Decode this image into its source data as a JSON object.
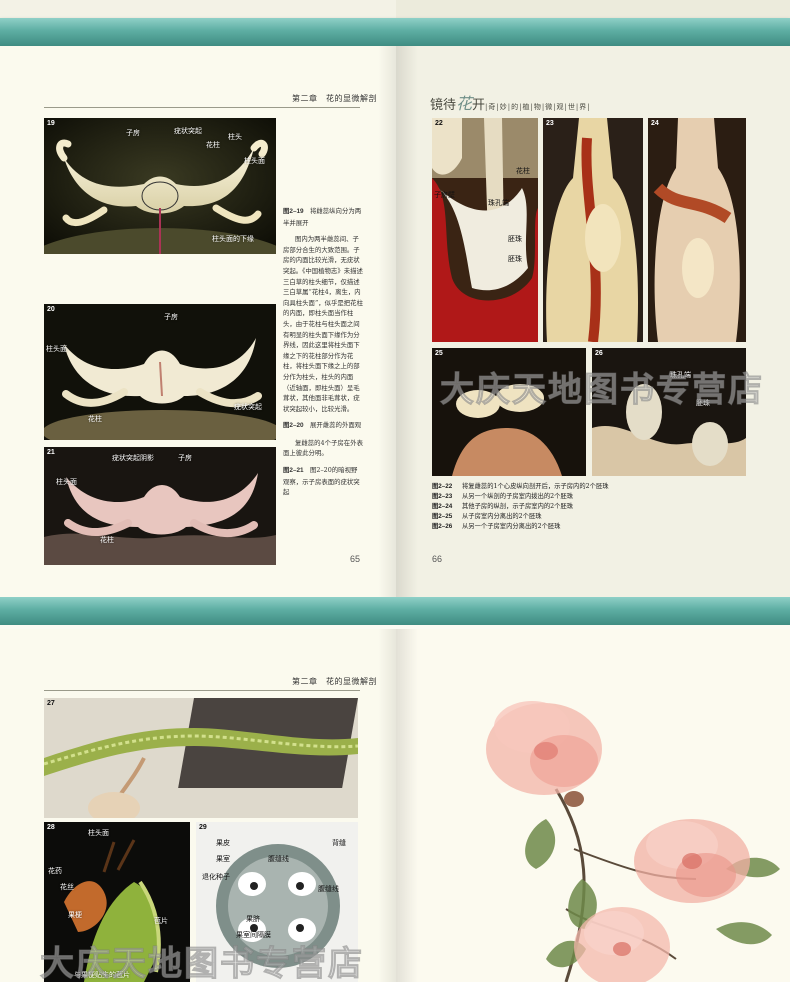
{
  "spread1": {
    "running_head_left": "第二章　花的显微解剖",
    "book_title_big": "镜待",
    "book_title_hua": "花",
    "book_title_kai": "开",
    "book_title_sub": "|奇|妙|的|植|物|微|观|世|界|",
    "folio_left": "65",
    "folio_right": "66",
    "figures_left": [
      {
        "num": "19",
        "labels": [
          "子房",
          "疣状突起",
          "花柱",
          "柱头",
          "柱头面",
          "柱头面的下缘"
        ]
      },
      {
        "num": "20",
        "labels": [
          "子房",
          "柱头面",
          "疣状突起",
          "花柱"
        ]
      },
      {
        "num": "21",
        "labels": [
          "疣状突起阴影",
          "子房",
          "柱头面",
          "花柱"
        ]
      }
    ],
    "caption_219_label": "图2–19",
    "caption_219_head": "将雌蕊纵向分为两半并展开",
    "caption_219_body": "图内为两半雌蕊间、子房部分合生的大致范围。子房的内面比较光滑，无疣状突起。《中国植物志》未描述三白草的柱头细节，仅描述三白草属“花柱4，离生，内向具柱头面”，似乎是把花柱的内面，即柱头面当作柱头，由于花柱与柱头面之间有明显的柱头面下缘作为分界线，因此这里将柱头面下缘之下的花柱部分作为花柱，将柱头面下缘之上的部分作为柱头，柱头的内面（近轴面，即柱头面）呈毛茸状，其他面非毛茸状，疣状突起较小，比较光滑。",
    "caption_220_label": "图2–20",
    "caption_220_head": "展开雌蕊的外面观",
    "caption_220_body": "复雌蕊的4个子房在外表面上彼此分明。",
    "caption_221_label": "图2–21",
    "caption_221_head": "图2–20的暗视野观察，示子房表面的疣状突起",
    "figures_right": [
      {
        "num": "22",
        "labels": [
          "花柱",
          "子房壁",
          "珠孔端",
          "胚珠",
          "胚珠"
        ]
      },
      {
        "num": "23",
        "labels": []
      },
      {
        "num": "24",
        "labels": []
      },
      {
        "num": "25",
        "labels": []
      },
      {
        "num": "26",
        "labels": [
          "珠孔端",
          "胚珠"
        ]
      }
    ],
    "captions_right": [
      {
        "label": "图2–22",
        "text": "将复雌蕊的1个心皮纵向剖开后，示子房内的2个胚珠"
      },
      {
        "label": "图2–23",
        "text": "从另一个纵剖的子房室内拨出的2个胚珠"
      },
      {
        "label": "图2–24",
        "text": "其他子房的纵剖，示子房室内的2个胚珠"
      },
      {
        "label": "图2–25",
        "text": "从子房室内分离出的2个胚珠"
      },
      {
        "label": "图2–26",
        "text": "从另一个子房室内分离出的2个胚珠"
      }
    ]
  },
  "spread2": {
    "running_head_left": "第二章　花的显微解剖",
    "figures": [
      {
        "num": "27",
        "labels": []
      },
      {
        "num": "28",
        "labels": [
          "柱头面",
          "花药",
          "花丝",
          "果梗",
          "苞片",
          "与果梗贴生的苞片"
        ]
      },
      {
        "num": "29",
        "labels": [
          "果皮",
          "背缝",
          "果室",
          "腹缝线",
          "退化种子",
          "腹缝线",
          "果脐",
          "果室间隔膜"
        ]
      }
    ]
  },
  "watermark_text": "大庆天地图书专营店",
  "colors": {
    "teal_band": "#5eaea3",
    "page": "#fbfaee",
    "page_right": "#f2f1e4"
  }
}
